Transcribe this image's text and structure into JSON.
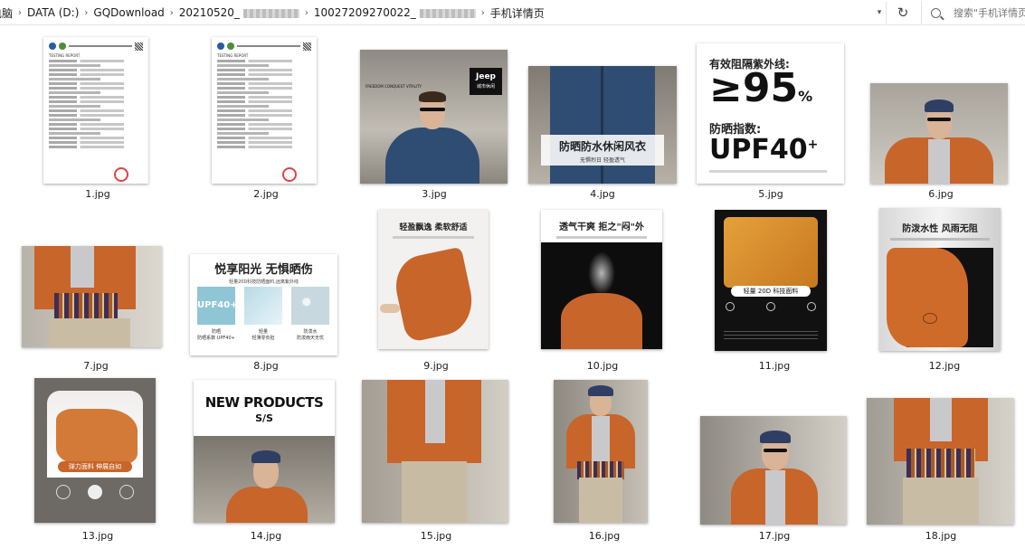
{
  "address_bar": {
    "crumbs": [
      "电脑",
      "DATA (D:)",
      "GQDownload",
      "20210520_",
      "10027209270022_",
      "手机详情页"
    ],
    "dropdown_icon": "chevron-down-icon",
    "refresh_icon": "refresh-icon"
  },
  "search": {
    "placeholder": "搜索\"手机详情页\"",
    "icon": "search-icon"
  },
  "files": [
    {
      "name": "1.jpg"
    },
    {
      "name": "2.jpg"
    },
    {
      "name": "3.jpg"
    },
    {
      "name": "4.jpg"
    },
    {
      "name": "5.jpg"
    },
    {
      "name": "6.jpg"
    },
    {
      "name": "7.jpg"
    },
    {
      "name": "8.jpg"
    },
    {
      "name": "9.jpg"
    },
    {
      "name": "10.jpg"
    },
    {
      "name": "11.jpg"
    },
    {
      "name": "12.jpg"
    },
    {
      "name": "13.jpg"
    },
    {
      "name": "14.jpg"
    },
    {
      "name": "15.jpg"
    },
    {
      "name": "16.jpg"
    },
    {
      "name": "17.jpg"
    },
    {
      "name": "18.jpg"
    }
  ],
  "thumb_text": {
    "t1_title": "TESTING REPORT",
    "t3_brand": "Jeep",
    "t3_brand_sub": "城市休闲",
    "t3_slogan": "FREEDOM CONQUEST VITALITY",
    "t4_title": "防晒防水休闲风衣",
    "t4_sub": "无惧烈日  轻盈透气",
    "t5_line1": "有效阻隔紫外线:",
    "t5_big": "≥95",
    "t5_pct": "%",
    "t5_line2": "防晒指数:",
    "t5_upf": "UPF40",
    "t5_plus": "+",
    "t8_title": "悦享阳光 无惧晒伤",
    "t8_sub": "轻量20D科技防晒面料,远离紫外线",
    "t8_badge": "UPF40+",
    "t8_cap1": "防晒",
    "t8_cap1b": "防晒系数 UPF40+",
    "t8_cap2": "轻量",
    "t8_cap2b": "轻薄零负担",
    "t8_cap3": "防泼水",
    "t8_cap3b": "防泼雨天无忧",
    "t9_title": "轻盈飘逸 柔软舒适",
    "t10_title": "透气干爽 拒之\"闷\"外",
    "t11_label": "轻量 20D 科技面料",
    "t12_title": "防泼水性 风雨无阻",
    "t13_label": "弹力面料 伸展自如",
    "t14_title": "NEW PRODUCTS",
    "t14_sub": "S/S"
  },
  "colors": {
    "orange": "#c8652a",
    "navy": "#2f4d73"
  }
}
